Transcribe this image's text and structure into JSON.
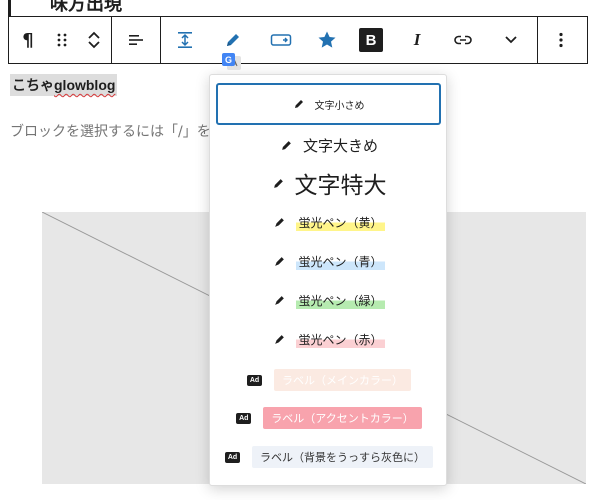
{
  "page": {
    "top_heading": "味方出現",
    "author": {
      "prefix": "こちゃ",
      "name": "glowblog"
    },
    "placeholder": "ブロックを選択するには「/」を入力"
  },
  "toolbar": {
    "paragraph": "¶",
    "drag": "⠿",
    "up": "⌃",
    "down": "⌄",
    "bold": "B",
    "italic": "I",
    "more": "⌄",
    "options": "⋮"
  },
  "translate_badge": "G",
  "dropdown": {
    "items": [
      {
        "label": "文字小さめ",
        "style": "small",
        "selected": true
      },
      {
        "label": "文字大きめ",
        "style": "large"
      },
      {
        "label": "文字特大",
        "style": "xlarge"
      },
      {
        "label": "蛍光ペン（黄）",
        "style": "hl-yellow"
      },
      {
        "label": "蛍光ペン（青）",
        "style": "hl-blue"
      },
      {
        "label": "蛍光ペン（緑）",
        "style": "hl-green"
      },
      {
        "label": "蛍光ペン（赤）",
        "style": "hl-red"
      },
      {
        "label": "ラベル（メインカラー）",
        "style": "lbl-main"
      },
      {
        "label": "ラベル（アクセントカラー）",
        "style": "lbl-accent"
      },
      {
        "label": "ラベル（背景をうっすら灰色に）",
        "style": "lbl-bg"
      }
    ],
    "ad_badge": "Ad"
  },
  "colors": {
    "accent": "#2271b1",
    "yellow": "#fff58a",
    "blue": "#cde6fb",
    "green": "#b6ebb0",
    "red": "#fbd0d3",
    "label_main": "#fbeae2",
    "label_accent": "#f8a3ad",
    "label_bg": "#eef2f8"
  }
}
